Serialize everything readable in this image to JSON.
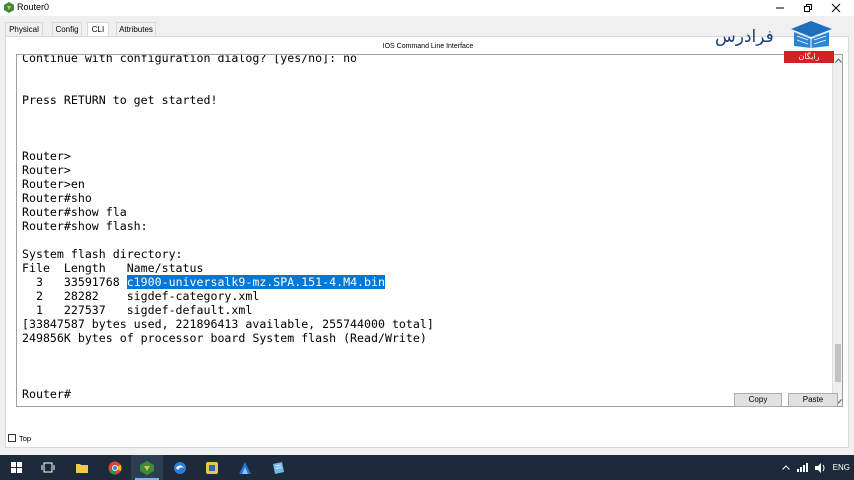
{
  "window": {
    "title": "Router0",
    "controls": [
      "minimize",
      "maximize",
      "close"
    ]
  },
  "tabs": [
    {
      "label": "Physical",
      "active": false
    },
    {
      "label": "Config",
      "active": false
    },
    {
      "label": "CLI",
      "active": true
    },
    {
      "label": "Attributes",
      "active": false
    }
  ],
  "cli": {
    "title": "IOS Command Line Interface",
    "lines": [
      {
        "text": "Continue with configuration dialog? [yes/no]: no"
      },
      {
        "text": ""
      },
      {
        "text": ""
      },
      {
        "text": "Press RETURN to get started!"
      },
      {
        "text": ""
      },
      {
        "text": ""
      },
      {
        "text": ""
      },
      {
        "text": "Router>"
      },
      {
        "text": "Router>"
      },
      {
        "text": "Router>en"
      },
      {
        "text": "Router#sho"
      },
      {
        "text": "Router#show fla"
      },
      {
        "text": "Router#show flash:"
      },
      {
        "text": ""
      },
      {
        "text": "System flash directory:"
      },
      {
        "text": "File  Length   Name/status"
      },
      {
        "text": "  3   33591768 ",
        "highlight": "c1900-universalk9-mz.SPA.151-4.M4.bin"
      },
      {
        "text": "  2   28282    sigdef-category.xml"
      },
      {
        "text": "  1   227537   sigdef-default.xml"
      },
      {
        "text": "[33847587 bytes used, 221896413 available, 255744000 total]"
      },
      {
        "text": "249856K bytes of processor board System flash (Read/Write)"
      },
      {
        "text": ""
      },
      {
        "text": ""
      },
      {
        "text": ""
      },
      {
        "text": "Router#"
      }
    ],
    "scroll_position": 0.9
  },
  "buttons": {
    "copy": "Copy",
    "paste": "Paste"
  },
  "top_checkbox": {
    "label": "Top",
    "checked": false
  },
  "logo": {
    "text": "فرادرس",
    "badge": "رایگان"
  },
  "taskbar": {
    "items": [
      "start-icon",
      "task-view-icon",
      "file-explorer-icon",
      "chrome-icon",
      "packet-tracer-icon",
      "browser-icon",
      "app-icon",
      "draw-icon",
      "notes-icon"
    ],
    "language": "ENG"
  },
  "colors": {
    "selection": "#0078d7",
    "taskbar": "#1c2a3a",
    "logo_blue": "#1f3f7a",
    "badge_red": "#d42020"
  }
}
